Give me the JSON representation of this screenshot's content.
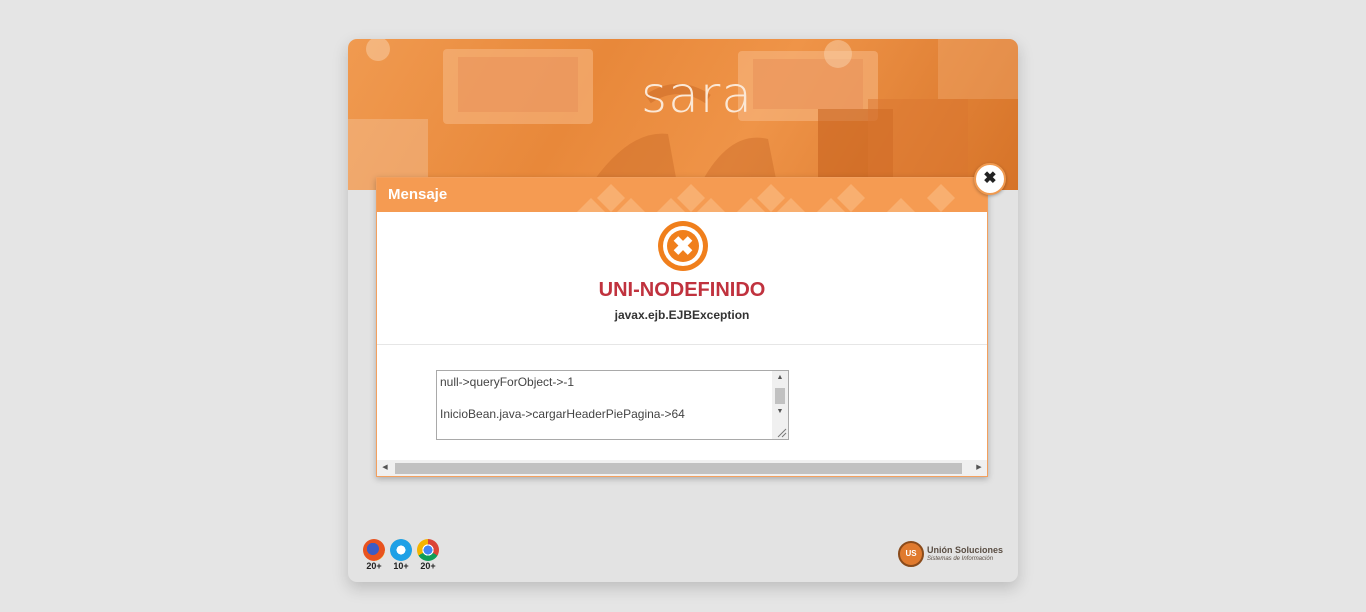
{
  "brand": {
    "logo_text": "sara",
    "accent": "#f59b52"
  },
  "dialog": {
    "title": "Mensaje",
    "icon": "error-circle-x-icon",
    "error_code": "UNI-NODEFINIDO",
    "exception": "javax.ejb.EJBException",
    "detail_lines": [
      "null->queryForObject->-1",
      "",
      "InicioBean.java->cargarHeaderPiePagina->64"
    ],
    "close_glyph": "✖"
  },
  "browsers": [
    {
      "name": "firefox-icon",
      "version": "20+"
    },
    {
      "name": "internet-explorer-icon",
      "version": "10+"
    },
    {
      "name": "chrome-icon",
      "version": "20+"
    }
  ],
  "company": {
    "name": "Unión Soluciones",
    "tagline": "Sistemas de Información",
    "badge": "US"
  }
}
